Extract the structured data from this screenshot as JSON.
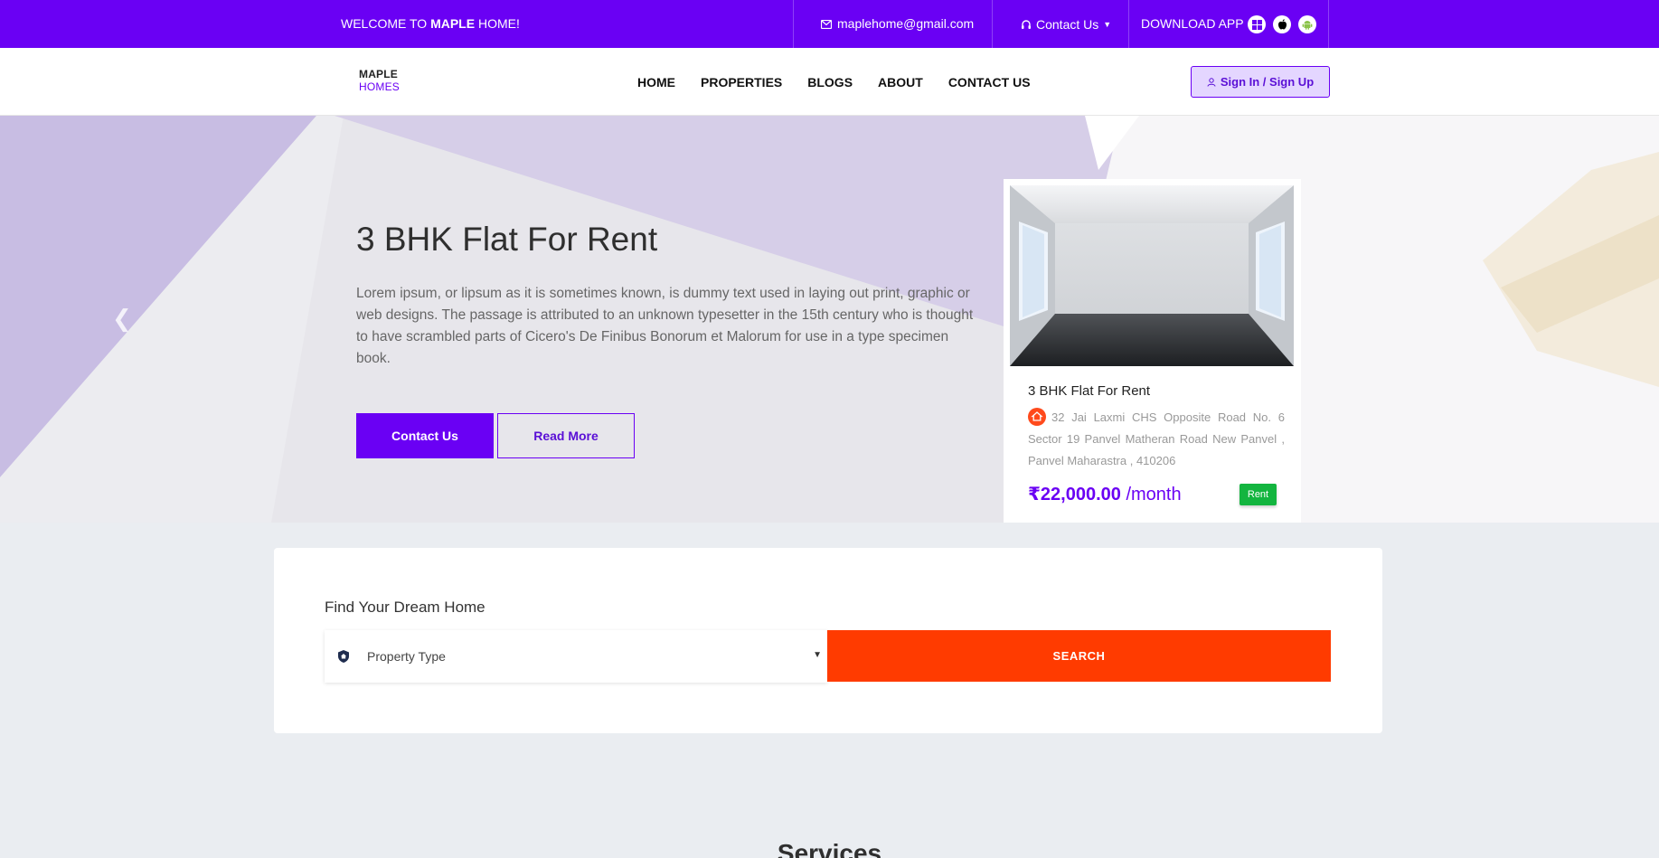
{
  "topbar": {
    "welcome_prefix": "WELCOME TO ",
    "welcome_brand": "MAPLE",
    "welcome_suffix": " HOME!",
    "email": "maplehome@gmail.com",
    "contact_label": "Contact Us",
    "download_label": "DOWNLOAD APP",
    "app_icons": [
      "windows-icon",
      "apple-icon",
      "android-icon"
    ]
  },
  "nav": {
    "logo_line1": "MAPLE",
    "logo_line2": "HOMES",
    "links": [
      "HOME",
      "PROPERTIES",
      "BLOGS",
      "ABOUT",
      "CONTACT US"
    ],
    "signin_label": "Sign In / Sign Up"
  },
  "hero": {
    "title": "3 BHK Flat For Rent",
    "description": "Lorem ipsum, or lipsum as it is sometimes known, is dummy text used in laying out print, graphic or web designs. The passage is attributed to an unknown typesetter in the 15th century who is thought to have scrambled parts of Cicero's De Finibus Bonorum et Malorum for use in a type specimen book.",
    "contact_button": "Contact Us",
    "read_more_button": "Read More"
  },
  "property_card": {
    "title": "3 BHK Flat For Rent",
    "address": "32 Jai Laxmi CHS Opposite Road No. 6 Sector 19 Panvel Matheran Road New Panvel , Panvel Maharastra , 410206",
    "price": "₹22,000.00",
    "price_unit": " /month",
    "badge": "Rent"
  },
  "search": {
    "title": "Find Your Dream Home",
    "property_type_placeholder": "Property Type",
    "search_button": "SEARCH"
  },
  "services": {
    "title": "Services"
  },
  "colors": {
    "brand": "#6a00f4",
    "search_button": "#ff3b00",
    "rent_badge": "#13b53f"
  }
}
